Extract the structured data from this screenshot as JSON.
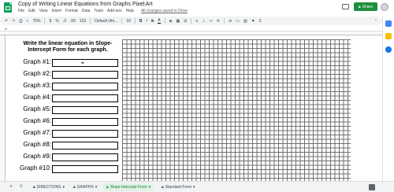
{
  "header": {
    "doc_title": "Copy of Writing Linear Equations from Graphs Pixel Art",
    "title_icons": "☆ 🗀",
    "menu": [
      "File",
      "Edit",
      "View",
      "Insert",
      "Format",
      "Data",
      "Tools",
      "Add-ons",
      "Help"
    ],
    "saved_status": "All changes saved in Drive",
    "share_label": "Share",
    "share_icon": "lock-icon"
  },
  "toolbar": {
    "undo": "↶",
    "redo": "↷",
    "print": "⎙",
    "paint_format": "⌁",
    "zoom": "75%",
    "currency": "$",
    "percent": "%",
    "dec_less": ".0",
    "dec_more": ".00",
    "format_123": "123",
    "font": "Default (Ari...",
    "font_size": "10",
    "bold": "B",
    "italic": "I",
    "strike": "S",
    "text_color": "A",
    "fill": "◈",
    "borders": "▦",
    "merge": "⊟",
    "halign": "≡",
    "valign": "⊥",
    "wrap": "↩",
    "rotate": "⟳",
    "link": "⊖",
    "comment": "▭",
    "chart": "▥",
    "filter": "▼",
    "functions": "Σ",
    "collapse": "⌃"
  },
  "formula_bar": {
    "fx": "fx"
  },
  "sheet": {
    "instructions": "Write the linear equation in Slope-Intercept Form for each graph.",
    "rows": [
      {
        "label": "Graph #1:"
      },
      {
        "label": "Graph #2:"
      },
      {
        "label": "Graph #3:"
      },
      {
        "label": "Graph #4:"
      },
      {
        "label": "Graph #5:"
      },
      {
        "label": "Graph #6:"
      },
      {
        "label": "Graph #7:"
      },
      {
        "label": "Graph #8:"
      },
      {
        "label": "Graph #9:"
      },
      {
        "label": "Graph #10:"
      }
    ]
  },
  "tabs": {
    "add": "+",
    "list": "≡",
    "items": [
      {
        "label": "DIRECTIONS",
        "active": false
      },
      {
        "label": "GRAPHS",
        "active": false
      },
      {
        "label": "Slope-Intercept Form",
        "active": true
      },
      {
        "label": "Standard Form",
        "active": false
      }
    ]
  },
  "colors": {
    "share": "#1e8e3e",
    "sheets_green": "#0f9d58",
    "active_tab": "#188038"
  }
}
